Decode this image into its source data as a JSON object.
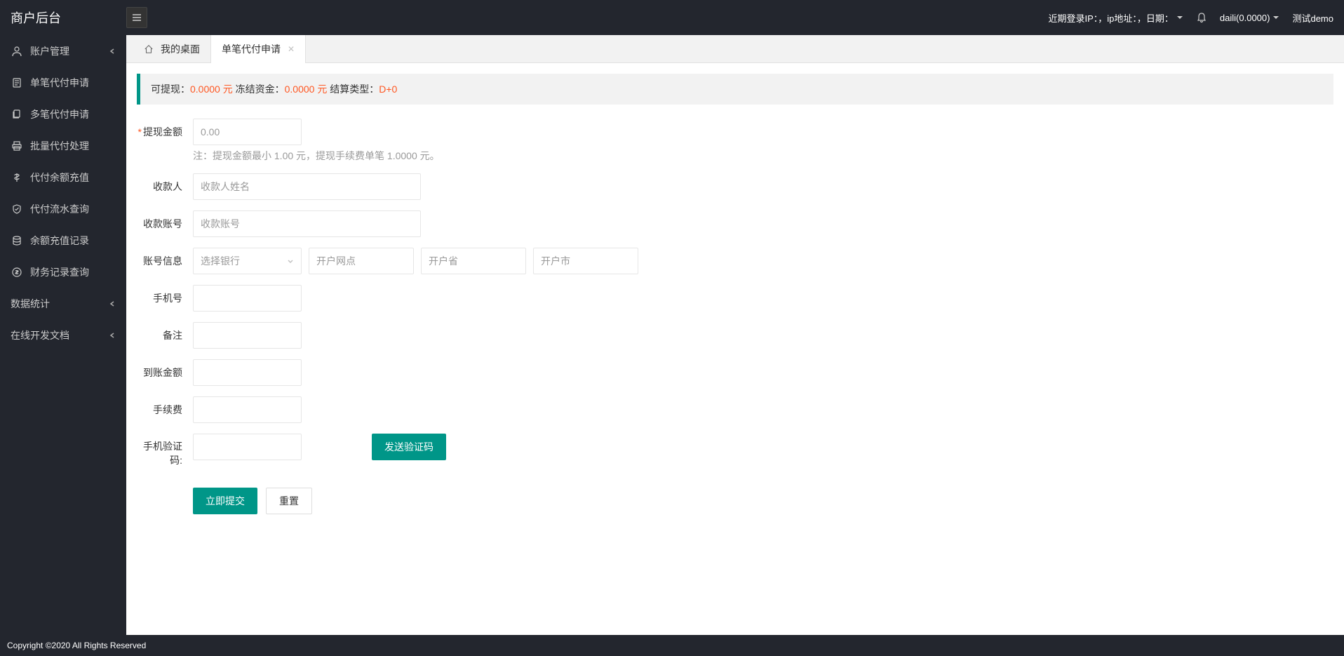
{
  "header": {
    "title": "商户后台",
    "loginInfo": "近期登录IP：，ip地址：，日期：",
    "userBalance": "daili(0.0000)",
    "testLabel": "测试demo"
  },
  "sidebar": {
    "items": [
      {
        "icon": "user",
        "label": "账户管理",
        "hasChildren": true
      },
      {
        "icon": "file",
        "label": "单笔代付申请",
        "hasChildren": false
      },
      {
        "icon": "files",
        "label": "多笔代付申请",
        "hasChildren": false
      },
      {
        "icon": "print",
        "label": "批量代付处理",
        "hasChildren": false
      },
      {
        "icon": "dollar",
        "label": "代付余额充值",
        "hasChildren": false
      },
      {
        "icon": "shield",
        "label": "代付流水查询",
        "hasChildren": false
      },
      {
        "icon": "db",
        "label": "余额充值记录",
        "hasChildren": false
      },
      {
        "icon": "circle-dollar",
        "label": "财务记录查询",
        "hasChildren": false
      },
      {
        "icon": "",
        "label": "数据统计",
        "hasChildren": true
      },
      {
        "icon": "",
        "label": "在线开发文档",
        "hasChildren": true
      }
    ]
  },
  "tabs": {
    "home": "我的桌面",
    "active": "单笔代付申请"
  },
  "infoBar": {
    "withdrawLabel": "可提现：",
    "withdrawValue": "0.0000 元",
    "frozenLabel": " 冻结资金：",
    "frozenValue": "0.0000 元",
    "settleLabel": " 结算类型：",
    "settleValue": "D+0"
  },
  "form": {
    "amount": {
      "label": "提现金额",
      "placeholder": "0.00"
    },
    "note": "注：提现金额最小 1.00 元，提现手续费单笔 1.0000 元。",
    "payee": {
      "label": "收款人",
      "placeholder": "收款人姓名"
    },
    "account": {
      "label": "收款账号",
      "placeholder": "收款账号"
    },
    "accountInfo": {
      "label": "账号信息"
    },
    "bank": {
      "placeholder": "选择银行"
    },
    "branch": {
      "placeholder": "开户网点"
    },
    "province": {
      "placeholder": "开户省"
    },
    "city": {
      "placeholder": "开户市"
    },
    "phone": {
      "label": "手机号"
    },
    "remark": {
      "label": "备注"
    },
    "arrivalAmount": {
      "label": "到账金额"
    },
    "fee": {
      "label": "手续费"
    },
    "smsCode": {
      "label": "手机验证码:"
    },
    "sendCode": "发送验证码",
    "submit": "立即提交",
    "reset": "重置"
  },
  "footer": "Copyright ©2020 All Rights Reserved"
}
